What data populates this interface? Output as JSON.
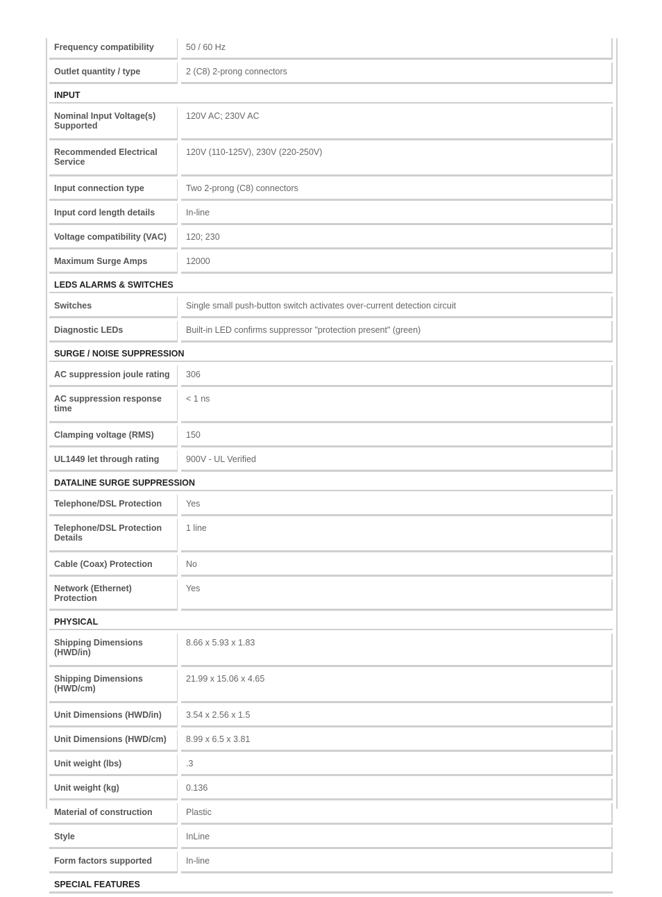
{
  "rows": [
    {
      "type": "row",
      "label": "Frequency compatibility",
      "value": "50 / 60 Hz"
    },
    {
      "type": "row",
      "label": "Outlet quantity / type",
      "value": "2 (C8) 2-prong connectors"
    },
    {
      "type": "section",
      "label": "INPUT"
    },
    {
      "type": "row",
      "label": "Nominal Input Voltage(s) Supported",
      "value": "120V AC; 230V AC",
      "tall": true
    },
    {
      "type": "row",
      "label": "Recommended Electrical Service",
      "value": "120V (110-125V), 230V (220-250V)",
      "tall": true
    },
    {
      "type": "row",
      "label": "Input connection type",
      "value": "Two 2-prong (C8) connectors"
    },
    {
      "type": "row",
      "label": "Input cord length details",
      "value": "In-line"
    },
    {
      "type": "row",
      "label": "Voltage compatibility (VAC)",
      "value": "120; 230"
    },
    {
      "type": "row",
      "label": "Maximum Surge Amps",
      "value": "12000"
    },
    {
      "type": "section",
      "label": "LEDS ALARMS & SWITCHES"
    },
    {
      "type": "row",
      "label": "Switches",
      "value": "Single small push-button switch activates over-current detection circuit"
    },
    {
      "type": "row",
      "label": "Diagnostic LEDs",
      "value": "Built-in LED confirms suppressor \"protection present\" (green)"
    },
    {
      "type": "section",
      "label": "SURGE / NOISE SUPPRESSION"
    },
    {
      "type": "row",
      "label": "AC suppression joule rating",
      "value": "306"
    },
    {
      "type": "row",
      "label": "AC suppression response time",
      "value": "< 1 ns",
      "tall": true
    },
    {
      "type": "row",
      "label": "Clamping voltage (RMS)",
      "value": "150"
    },
    {
      "type": "row",
      "label": "UL1449 let through rating",
      "value": "900V - UL Verified"
    },
    {
      "type": "section",
      "label": "DATALINE SURGE SUPPRESSION"
    },
    {
      "type": "row",
      "label": "Telephone/DSL Protection",
      "value": "Yes"
    },
    {
      "type": "row",
      "label": "Telephone/DSL Protection Details",
      "value": "1 line",
      "tall": true
    },
    {
      "type": "row",
      "label": "Cable (Coax) Protection",
      "value": "No"
    },
    {
      "type": "row",
      "label": "Network (Ethernet) Protection",
      "value": "Yes"
    },
    {
      "type": "section",
      "label": "PHYSICAL"
    },
    {
      "type": "row",
      "label": "Shipping Dimensions (HWD/in)",
      "value": "8.66 x 5.93 x 1.83",
      "tall": true
    },
    {
      "type": "row",
      "label": "Shipping Dimensions (HWD/cm)",
      "value": "21.99 x 15.06 x 4.65",
      "tall": true
    },
    {
      "type": "row",
      "label": "Unit Dimensions (HWD/in)",
      "value": "3.54 x 2.56 x 1.5"
    },
    {
      "type": "row",
      "label": "Unit Dimensions (HWD/cm)",
      "value": "8.99 x 6.5 x 3.81"
    },
    {
      "type": "row",
      "label": "Unit weight (lbs)",
      "value": ".3"
    },
    {
      "type": "row",
      "label": "Unit weight (kg)",
      "value": "0.136"
    },
    {
      "type": "row",
      "label": "Material of construction",
      "value": "Plastic"
    },
    {
      "type": "row",
      "label": "Style",
      "value": "InLine"
    },
    {
      "type": "row",
      "label": "Form factors supported",
      "value": "In-line"
    },
    {
      "type": "section",
      "label": "SPECIAL FEATURES",
      "last": true
    }
  ]
}
